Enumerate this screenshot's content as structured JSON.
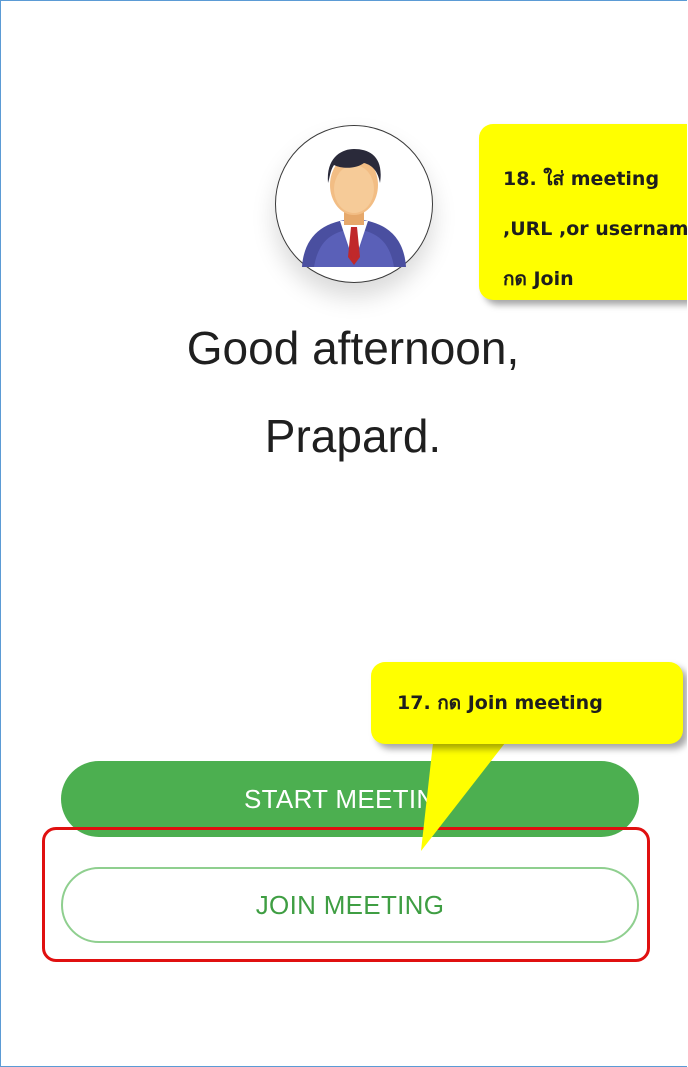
{
  "greeting": {
    "line1": "Good afternoon,",
    "line2": "Prapard."
  },
  "buttons": {
    "start_label": "START MEETING",
    "join_label": "JOIN MEETING"
  },
  "annotations": {
    "step18_lines": [
      "18. ใส่ meeting",
      ",URL ,or username",
      "กด Join"
    ],
    "step17_label": "17. กด Join meeting"
  },
  "colors": {
    "start_bg": "#4caf50",
    "join_text": "#3f9e43",
    "join_border": "#8fcf8f",
    "highlight": "#e01010",
    "callout": "#ffff00"
  }
}
